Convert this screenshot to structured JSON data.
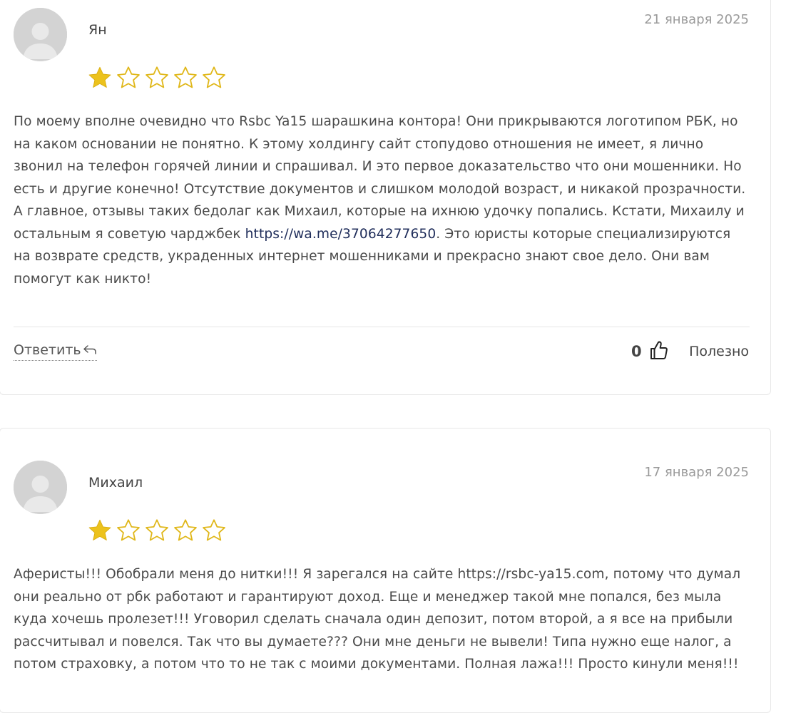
{
  "colors": {
    "star_filled": "#ecc21c",
    "star_outline": "#e0b719",
    "link": "#1f2d5a",
    "date": "#9a9a9a",
    "avatar_bg": "#d3d3d3"
  },
  "reviews": [
    {
      "author": "Ян",
      "date": "21 января 2025",
      "rating": 1,
      "max_rating": 5,
      "text_before_link": "По моему вполне очевидно что Rsbc Ya15 шарашкина контора! Они прикрываются логотипом РБК, но на каком основании не понятно. К этому холдингу сайт стопудово отношения не имеет, я лично звонил на телефон горячей линии и спрашивал. И это первое доказательство что они мошенники. Но есть и другие конечно! Отсутствие документов и слишком молодой возраст, и никакой прозрачности. А главное, отзывы таких бедолаг как Михаил, которые на ихнюю удочку попались. Кстати, Михаилу и остальным я советую чарджбек ",
      "link": "https://wa.me/37064277650",
      "text_after_link": ". Это юристы которые специализируются на возврате средств, украденных интернет мошенниками и прекрасно знают свое дело. Они вам помогут как никто!",
      "reply_label": "Ответить",
      "reply_icon": "reply-arrow-icon",
      "helpful_count": "0",
      "helpful_label": "Полезно"
    },
    {
      "author": "Михаил",
      "date": "17 января 2025",
      "rating": 1,
      "max_rating": 5,
      "text_before_link": "Аферисты!!! Обобрали меня до нитки!!! Я зарегался на сайте https://rsbc-ya15.com, потому что думал они реально от рбк работают и гарантируют доход. Еще и менеджер такой мне попался, без мыла куда хочешь пролезет!!! Уговорил сделать сначала один депозит, потом второй, а я все на прибыли рассчитывал и повелся. Так что вы думаете??? Они мне деньги не вывели! Типа нужно еще налог, а потом страховку, а потом что то не так с моими документами. Полная лажа!!! Просто кинули меня!!!",
      "link": "",
      "text_after_link": ""
    }
  ]
}
